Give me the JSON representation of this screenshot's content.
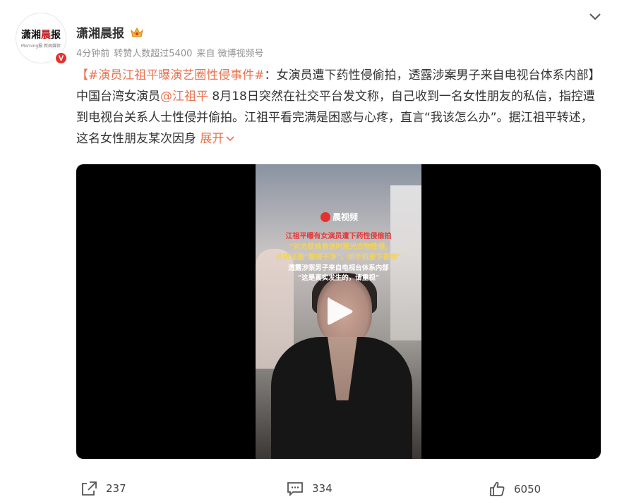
{
  "account": {
    "name": "潇湘晨报",
    "avatar_logo_left": "潇湘",
    "avatar_logo_red": "晨",
    "avatar_logo_right": "报",
    "avatar_sub": "Morning报 新闻媒体",
    "verified_badge": "V"
  },
  "meta": {
    "time": "4分钟前",
    "reposts_note": "转赞人数超过5400",
    "source": "来自 微博视频号"
  },
  "post": {
    "bracket_open": "【",
    "hashtag": "#演员江祖平曝演艺圈性侵事件#",
    "text_1": "：女演员遭下药性侵偷拍，透露涉案男子来自电视台体系内部】中国台湾女演员",
    "mention": "@江祖平",
    "text_2": " 8月18日突然在社交平台发文称，自己收到一名女性朋友的私信，指控遭到电视台关系人士性侵并偷拍。江祖平看完满是困惑与心疼，直言“我该怎么办”。据江祖平转述，这名女性朋友某次因身 ",
    "expand": "展开"
  },
  "video": {
    "brand": "晨视频",
    "caption_1": "江祖平曝有女演员遭下药性侵偷拍",
    "caption_2": "“对方趁她昏迷时脱光衣物性侵,",
    "caption_3": "还将证据“整理干净”，用手机录下视频”",
    "caption_4": "透露涉案男子来自电视台体系内部",
    "caption_5": "“这是真实发生的，请重视”"
  },
  "actions": {
    "repost_count": "237",
    "comment_count": "334",
    "like_count": "6050"
  },
  "colors": {
    "link": "#eb7350",
    "meta": "#939393",
    "verified": "#e5322d"
  }
}
